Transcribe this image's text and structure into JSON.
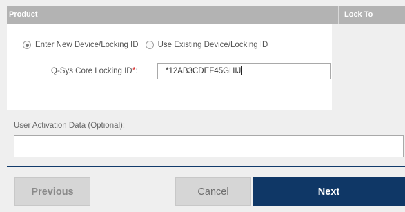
{
  "header": {
    "product_label": "Product",
    "lock_to_label": "Lock To"
  },
  "product": {
    "radio_options": [
      {
        "label": "Enter New Device/Locking ID",
        "selected": true
      },
      {
        "label": "Use Existing Device/Locking ID",
        "selected": false
      }
    ],
    "locking_id_label": "Q-Sys Core Locking ID",
    "required_marker": "*",
    "label_suffix": ":",
    "locking_id_value": "*12AB3CDEF45GHIJ"
  },
  "activation": {
    "label": "User Activation Data (Optional):",
    "value": ""
  },
  "buttons": {
    "previous": "Previous",
    "cancel": "Cancel",
    "next": "Next"
  },
  "colors": {
    "header_bg": "#b3b3b3",
    "primary": "#0f3766",
    "required": "#d62b2b"
  }
}
